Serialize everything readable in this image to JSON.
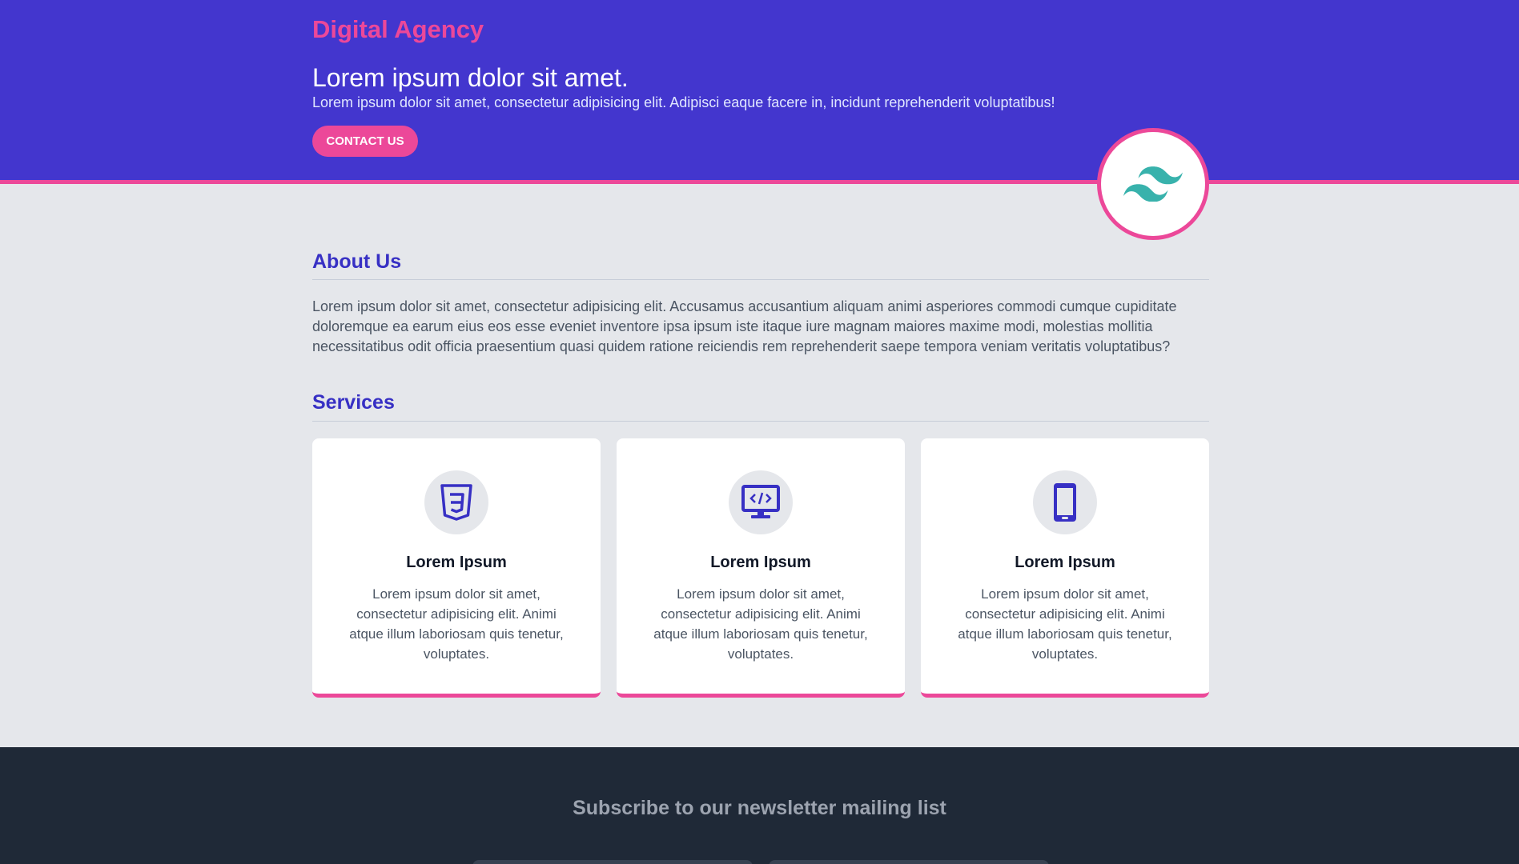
{
  "hero": {
    "brand": "Digital Agency",
    "headline": "Lorem ipsum dolor sit amet.",
    "subtext": "Lorem ipsum dolor sit amet, consectetur adipisicing elit. Adipisci eaque facere in, incidunt reprehenderit voluptatibus!",
    "cta_label": "CONTACT US"
  },
  "logo_icon": "tailwind-logo-icon",
  "about": {
    "title": "About Us",
    "text": "Lorem ipsum dolor sit amet, consectetur adipisicing elit. Accusamus accusantium aliquam animi asperiores commodi cumque cupiditate doloremque ea earum eius eos esse eveniet inventore ipsa ipsum iste itaque iure magnam maiores maxime modi, molestias mollitia necessitatibus odit officia praesentium quasi quidem ratione reiciendis rem reprehenderit saepe tempora veniam veritatis voluptatibus?"
  },
  "services": {
    "title": "Services",
    "cards": [
      {
        "icon": "css3-icon",
        "title": "Lorem Ipsum",
        "text": "Lorem ipsum dolor sit amet, consectetur adipisicing elit. Animi atque illum laboriosam quis tenetur, voluptates."
      },
      {
        "icon": "monitor-code-icon",
        "title": "Lorem Ipsum",
        "text": "Lorem ipsum dolor sit amet, consectetur adipisicing elit. Animi atque illum laboriosam quis tenetur, voluptates."
      },
      {
        "icon": "mobile-phone-icon",
        "title": "Lorem Ipsum",
        "text": "Lorem ipsum dolor sit amet, consectetur adipisicing elit. Animi atque illum laboriosam quis tenetur, voluptates."
      }
    ]
  },
  "footer": {
    "title": "Subscribe to our newsletter mailing list"
  },
  "colors": {
    "primary": "#4336ce",
    "accent": "#ec4899",
    "background": "#e5e7eb",
    "footer": "#1f2937",
    "heading": "#3730c4"
  }
}
